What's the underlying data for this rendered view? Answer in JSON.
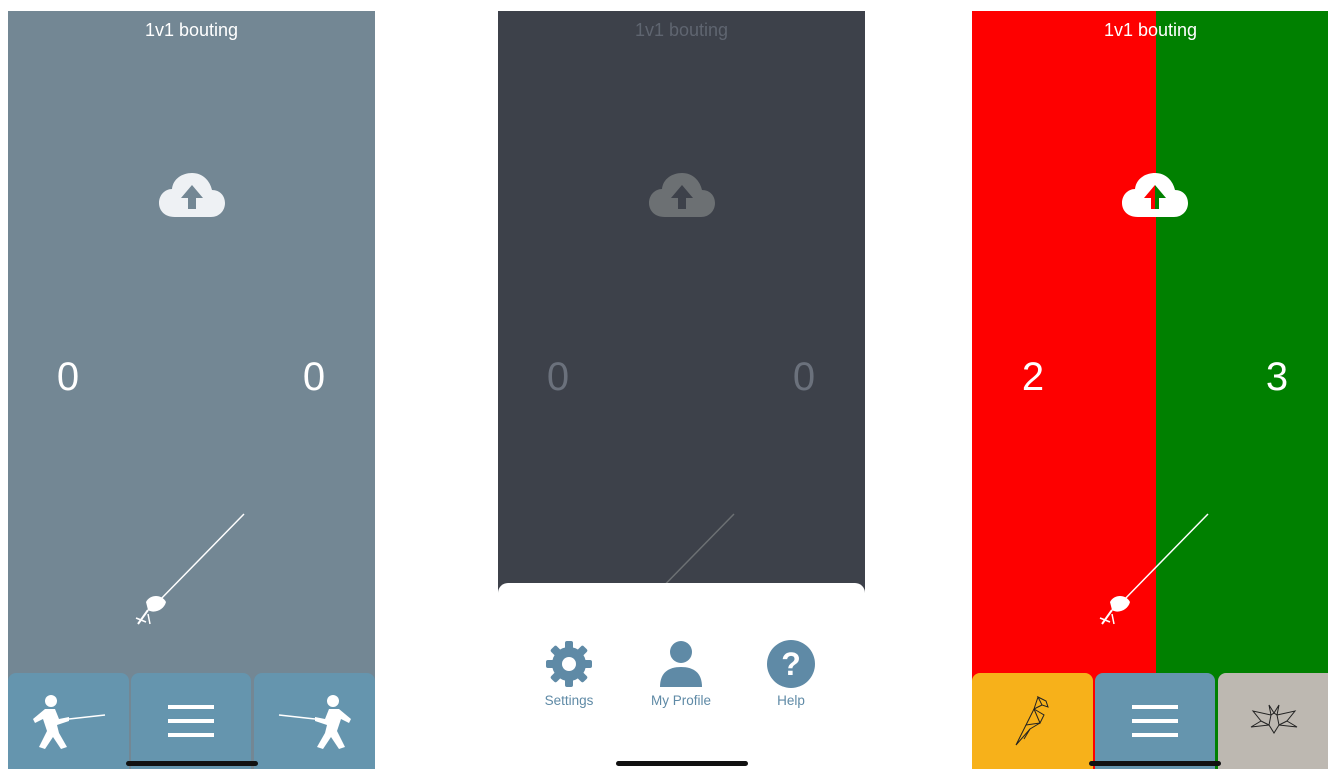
{
  "screens": [
    {
      "title": "1v1 bouting",
      "score_left": "0",
      "score_right": "0",
      "upload_icon": "cloud-upload-icon",
      "left_button_icon": "fencer-left-icon",
      "menu_button_icon": "hamburger-menu-icon",
      "right_button_icon": "fencer-right-icon"
    },
    {
      "title": "1v1 bouting",
      "score_left": "0",
      "score_right": "0",
      "menu": [
        {
          "label": "Settings",
          "icon": "gear-icon"
        },
        {
          "label": "My Profile",
          "icon": "person-icon"
        },
        {
          "label": "Help",
          "icon": "question-icon"
        }
      ]
    },
    {
      "title": "1v1 bouting",
      "score_left": "2",
      "score_right": "3",
      "left_color": "#fe0000",
      "right_color": "#008000",
      "left_button_icon": "parrot-origami-icon",
      "menu_button_icon": "hamburger-menu-icon",
      "right_button_icon": "bat-origami-icon"
    }
  ],
  "colors": {
    "screen1_bg": "#738794",
    "screen2_bg": "#3d414a",
    "button_blue": "#6595ae",
    "button_yellow": "#f7b11a",
    "button_gray": "#bdb8b1"
  }
}
